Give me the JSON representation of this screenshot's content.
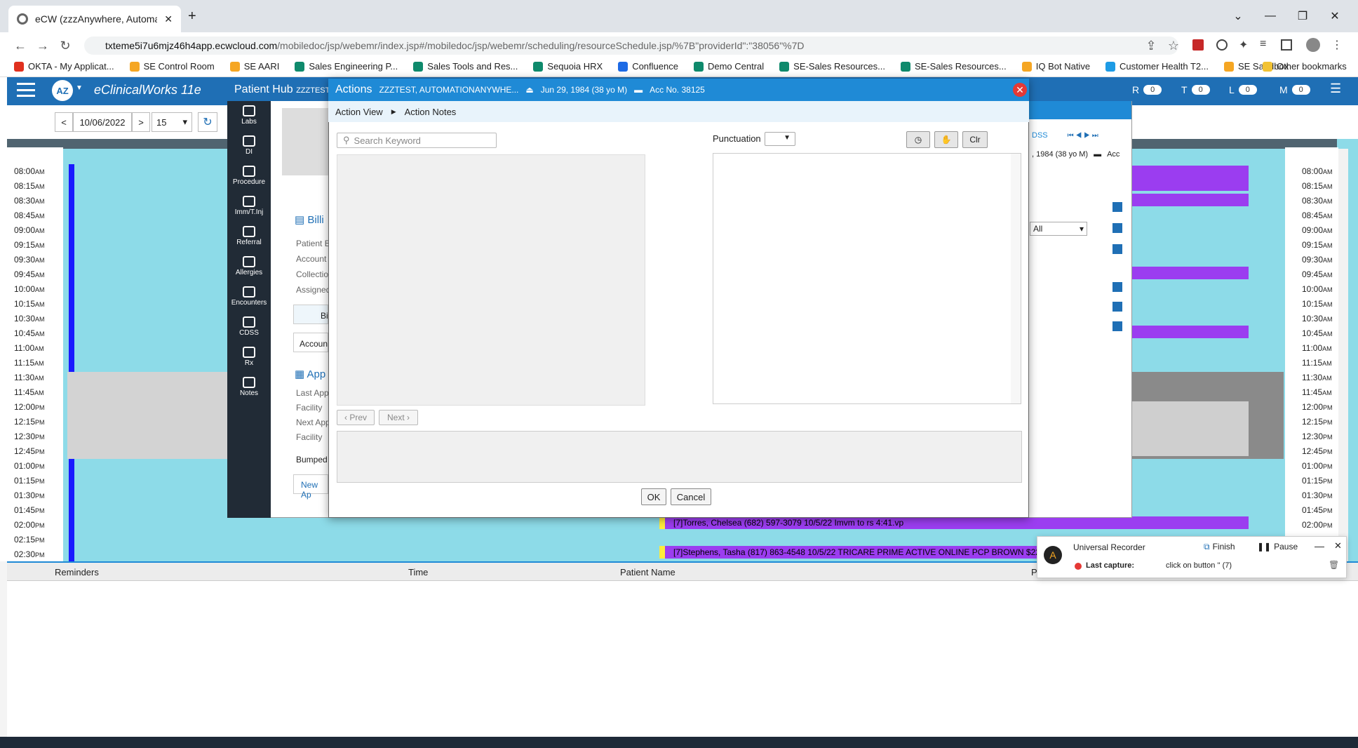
{
  "browser": {
    "tab_title": "eCW (zzzAnywhere, Automation",
    "new_tab": "+",
    "url_host": "txteme5i7u6mjz46h4app.ecwcloud.com",
    "url_path": "/mobiledoc/jsp/webemr/index.jsp#/mobiledoc/jsp/webemr/scheduling/resourceSchedule.jsp/%7B\"providerId\":\"38056\"%7D",
    "bookmarks": [
      {
        "label": "OKTA - My Applicat...",
        "color": "#e0301e"
      },
      {
        "label": "SE Control Room",
        "color": "#f5a623"
      },
      {
        "label": "SE AARI",
        "color": "#f5a623"
      },
      {
        "label": "Sales Engineering P...",
        "color": "#0f8a6c"
      },
      {
        "label": "Sales Tools and Res...",
        "color": "#0f8a6c"
      },
      {
        "label": "Sequoia HRX",
        "color": "#0f8a6c"
      },
      {
        "label": "Confluence",
        "color": "#1d6ae5"
      },
      {
        "label": "Demo Central",
        "color": "#0f8a6c"
      },
      {
        "label": "SE-Sales Resources...",
        "color": "#0f8a6c"
      },
      {
        "label": "SE-Sales Resources...",
        "color": "#0f8a6c"
      },
      {
        "label": "IQ Bot Native",
        "color": "#f5a623"
      },
      {
        "label": "Customer Health T2...",
        "color": "#1d9be5"
      },
      {
        "label": "SE Sandbox",
        "color": "#f5a623"
      }
    ],
    "other_bookmarks": "Other bookmarks"
  },
  "ecw": {
    "avatar": "AZ",
    "brand": "eClinicalWorks 11e",
    "counters": [
      {
        "letter": "R",
        "count": "0"
      },
      {
        "letter": "T",
        "count": "0"
      },
      {
        "letter": "L",
        "count": "0"
      },
      {
        "letter": "M",
        "count": "0"
      }
    ],
    "date": "10/06/2022",
    "interval": "15",
    "times": [
      "08:00",
      "08:15",
      "08:30",
      "08:45",
      "09:00",
      "09:15",
      "09:30",
      "09:45",
      "10:00",
      "10:15",
      "10:30",
      "10:45",
      "11:00",
      "11:15",
      "11:30",
      "11:45",
      "12:00",
      "12:15",
      "12:30",
      "12:45",
      "01:00",
      "01:15",
      "01:30",
      "01:45",
      "02:00",
      "02:15",
      "02:30"
    ],
    "ampm": [
      "AM",
      "AM",
      "AM",
      "AM",
      "AM",
      "AM",
      "AM",
      "AM",
      "AM",
      "AM",
      "AM",
      "AM",
      "AM",
      "AM",
      "AM",
      "AM",
      "PM",
      "PM",
      "PM",
      "PM",
      "PM",
      "PM",
      "PM",
      "PM",
      "PM",
      "PM",
      "PM"
    ],
    "appointments": [
      "[7]Torres, Chelsea (682) 597-3079 10/5/22 Imvm to rs 4:41.vp",
      "[7]Stephens, Tasha (817) 863-4548 10/5/22 TRICARE PRIME ACTIVE ONLINE PCP BROWN $22.VP"
    ]
  },
  "hub": {
    "title": "Patient Hub",
    "patient_short": "ZZZTEST, A",
    "side_items": [
      "Labs",
      "DI",
      "Procedure",
      "Imm/T.Inj",
      "Referral",
      "Allergies",
      "Encounters",
      "CDSS",
      "Rx",
      "Notes"
    ],
    "billing_title": "Billi",
    "billing_rows": [
      "Patient B",
      "Account",
      "Collectio",
      "Assigned"
    ],
    "bill_btn": "Bil",
    "account_btn": "Accoun",
    "appt_title": "App",
    "appt_rows": [
      "Last App",
      "Facility",
      "Next App",
      "Facility"
    ],
    "bumped": "Bumped",
    "new_appt": "New Ap",
    "right_dob": ", 1984 (38 yo M)",
    "right_acc": "Acc",
    "right_filter": "All",
    "right_tab": "DSS"
  },
  "dialog": {
    "title": "Actions",
    "patient": "ZZZTEST, AUTOMATIONANYWHE...",
    "dob": "Jun 29, 1984 (38 yo M)",
    "acc": "Acc No. 38125",
    "crumb_root": "Action View",
    "crumb_current": "Action Notes",
    "search_placeholder": "Search Keyword",
    "punctuation_label": "Punctuation",
    "clr": "Clr",
    "prev": "Prev",
    "next": "Next",
    "ok": "OK",
    "cancel": "Cancel"
  },
  "bottom": {
    "columns": [
      "Reminders",
      "Time",
      "Patient Name",
      "P"
    ]
  },
  "recorder": {
    "title": "Universal Recorder",
    "finish": "Finish",
    "pause": "Pause",
    "last_capture_label": "Last capture:",
    "last_capture_value": "click on button '' (7)"
  }
}
